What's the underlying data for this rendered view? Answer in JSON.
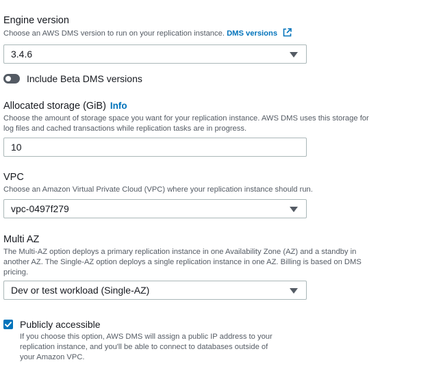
{
  "engine": {
    "label": "Engine version",
    "description": "Choose an AWS DMS version to run on your replication instance.",
    "link": "DMS versions",
    "selected": "3.4.6"
  },
  "beta": {
    "label": "Include Beta DMS versions",
    "enabled": false
  },
  "storage": {
    "label": "Allocated storage (GiB)",
    "info": "Info",
    "description_line1": "Choose the amount of storage space you want for your replication instance. AWS DMS uses this storage for",
    "description_line2": "log files and cached transactions while replication tasks are in progress.",
    "value": "10"
  },
  "vpc": {
    "label": "VPC",
    "description": "Choose an Amazon Virtual Private Cloud (VPC) where your replication instance should run.",
    "selected": "vpc-0497f279"
  },
  "multi_az": {
    "label": "Multi AZ",
    "description_line1": "The Multi-AZ option deploys a primary replication instance in one Availability Zone (AZ) and a standby in",
    "description_line2": "another AZ. The Single-AZ option deploys a single replication instance in one AZ. Billing is based on DMS",
    "description_line3": "pricing.",
    "selected": "Dev or test workload (Single-AZ)"
  },
  "public": {
    "label": "Publicly accessible",
    "checked": true,
    "description_line1": "If you choose this option, AWS DMS will assign a public IP address to your",
    "description_line2": "replication instance, and you'll be able to connect to databases outside of",
    "description_line3": "your Amazon VPC."
  },
  "colors": {
    "link": "#0073bb",
    "text": "#16191f",
    "secondary": "#545b64",
    "border": "#aab7b8"
  }
}
